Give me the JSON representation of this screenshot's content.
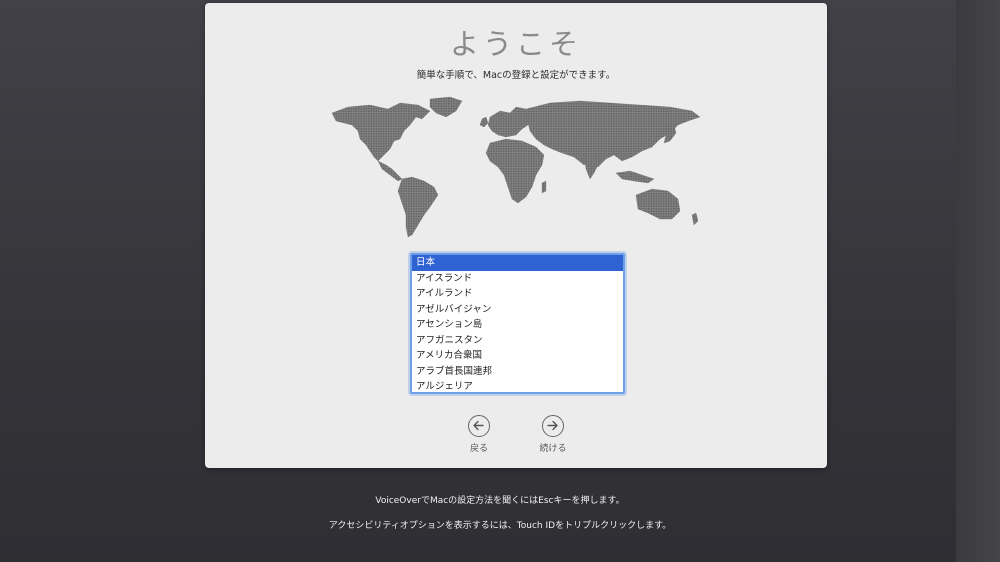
{
  "welcome": {
    "title": "ようこそ",
    "subtitle": "簡単な手順で、Macの登録と設定ができます。"
  },
  "country_list": {
    "items": [
      {
        "label": "日本",
        "selected": true
      },
      {
        "label": "アイスランド",
        "selected": false
      },
      {
        "label": "アイルランド",
        "selected": false
      },
      {
        "label": "アゼルバイジャン",
        "selected": false
      },
      {
        "label": "アセンション島",
        "selected": false
      },
      {
        "label": "アフガニスタン",
        "selected": false
      },
      {
        "label": "アメリカ合衆国",
        "selected": false
      },
      {
        "label": "アラブ首長国連邦",
        "selected": false
      },
      {
        "label": "アルジェリア",
        "selected": false
      }
    ]
  },
  "nav": {
    "back_label": "戻る",
    "continue_label": "続ける"
  },
  "footer": {
    "voiceover_hint": "VoiceOverでMacの設定方法を聞くにはEscキーを押します。",
    "accessibility_hint": "アクセシビリティオプションを表示するには、Touch IDをトリプルクリックします。"
  },
  "colors": {
    "selection": "#2f62d3",
    "focus_ring": "#6c9fe8",
    "panel": "#ececec",
    "map": "#6e6e6e"
  },
  "icons": {
    "back": "arrow-left-circle-icon",
    "continue": "arrow-right-circle-icon",
    "map": "world-map"
  }
}
